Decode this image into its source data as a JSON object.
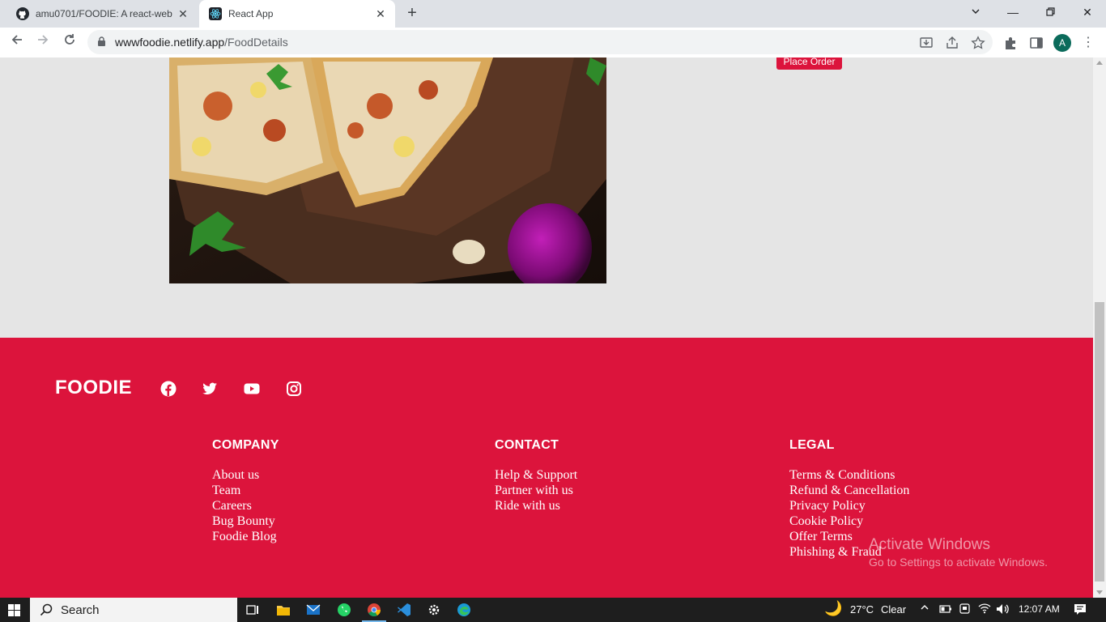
{
  "browser": {
    "tabs": [
      {
        "title": "amu0701/FOODIE: A react-web a",
        "icon": "github-icon",
        "active": false
      },
      {
        "title": "React App",
        "icon": "react-icon",
        "active": true
      }
    ],
    "url_host": "wwwfoodie.netlify.app",
    "url_path": "/FoodDetails",
    "profile_initial": "A"
  },
  "page": {
    "place_order_label": "Place Order"
  },
  "footer": {
    "brand": "FOODIE",
    "social_icons": [
      "facebook-icon",
      "twitter-icon",
      "youtube-icon",
      "instagram-icon"
    ],
    "columns": [
      {
        "heading": "COMPANY",
        "links": [
          "About us",
          "Team",
          "Careers",
          "Bug Bounty",
          "Foodie Blog"
        ]
      },
      {
        "heading": "CONTACT",
        "links": [
          "Help & Support",
          "Partner with us",
          "Ride with us"
        ]
      },
      {
        "heading": "LEGAL",
        "links": [
          "Terms & Conditions",
          "Refund & Cancellation",
          "Privacy Policy",
          "Cookie Policy",
          "Offer Terms",
          "Phishing & Fraud"
        ]
      }
    ],
    "watermark_title": "Activate Windows",
    "watermark_sub": "Go to Settings to activate Windows."
  },
  "taskbar": {
    "search_label": "Search",
    "weather_temp": "27°C",
    "weather_text": "Clear",
    "time": "12:07 AM"
  },
  "colors": {
    "brand": "#dc143c",
    "page_bg": "#e5e5e5"
  }
}
